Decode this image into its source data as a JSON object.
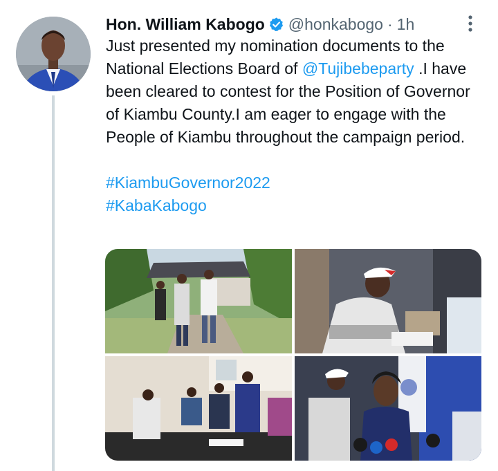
{
  "tweet": {
    "author_name": "Hon. William Kabogo",
    "author_handle": "@honkabogo",
    "separator": "·",
    "time": "1h",
    "text_part1": "Just presented my nomination documents to the National Elections Board of ",
    "mention": "@Tujibebeparty",
    "text_part2": " .I have been cleared to contest for the Position of Governor of Kiambu County.I am eager to engage with the People of Kiambu throughout the campaign period.",
    "hashtags": [
      "#KiambuGovernor2022",
      "#KabaKabogo"
    ]
  },
  "icons": {
    "verified": "verified-badge-icon",
    "more": "more-options-icon"
  },
  "colors": {
    "link": "#1d9bf0",
    "secondary_text": "#536471",
    "thread_line": "#cfd9de",
    "verified": "#1d9bf0"
  }
}
